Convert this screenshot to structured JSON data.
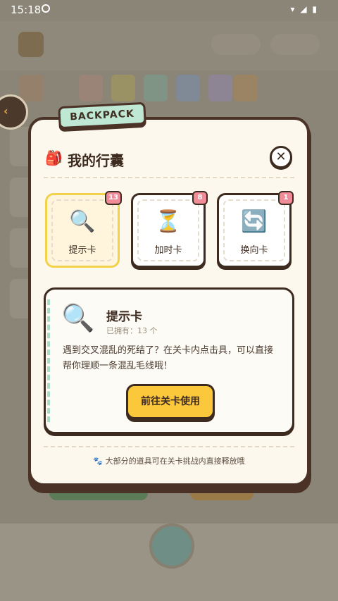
{
  "status_bar": {
    "time": "15:18",
    "icons": "▾ ◢ ▮"
  },
  "backpack": {
    "tag": "BACKPACK",
    "title": "我的行囊",
    "title_icon": "backpack-icon",
    "close_symbol": "✕",
    "items": [
      {
        "label": "提示卡",
        "count": "13",
        "icon": "🔍"
      },
      {
        "label": "加时卡",
        "count": "8",
        "icon": "⏳"
      },
      {
        "label": "换向卡",
        "count": "1",
        "icon": "🔄"
      }
    ],
    "selected_index": 0,
    "detail": {
      "icon": "🔍",
      "name": "提示卡",
      "owned": "已拥有：13 个",
      "description": "遇到交叉混乱的死结了？在关卡内点击具，可以直接帮你理顺一条混乱毛线哦！",
      "button": "前往关卡使用"
    },
    "footer_tip": "🐾 大部分的道具可在关卡挑战内直接释放哦"
  },
  "colors": {
    "accent_yellow": "#fcc83b",
    "badge_pink": "#f08c98",
    "tag_mint": "#bfe8d4",
    "outline_brown": "#3d2b1f"
  }
}
